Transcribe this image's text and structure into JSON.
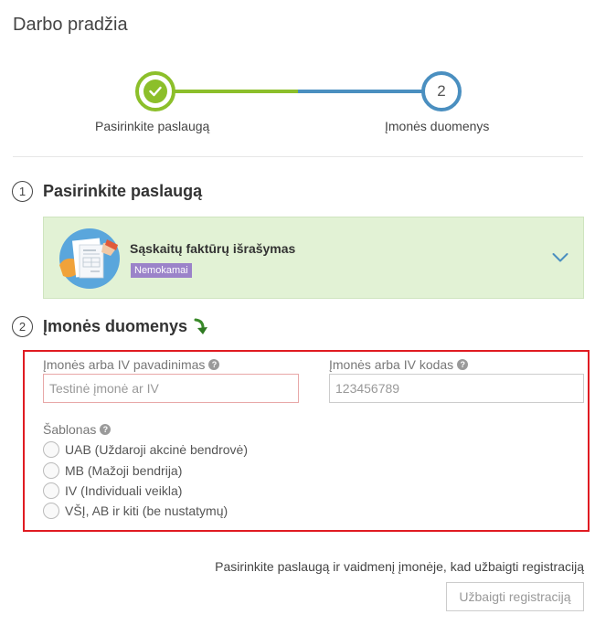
{
  "page": {
    "title": "Darbo pradžia"
  },
  "stepper": {
    "steps": [
      {
        "label": "Pasirinkite paslaugą",
        "state": "done"
      },
      {
        "label": "Įmonės duomenys",
        "number": "2",
        "state": "active"
      }
    ]
  },
  "sections": {
    "service": {
      "number": "1",
      "title": "Pasirinkite paslaugą"
    },
    "company": {
      "number": "2",
      "title": "Įmonės duomenys"
    }
  },
  "service_card": {
    "name": "Sąskaitų faktūrų išrašymas",
    "badge": "Nemokamai",
    "icon": "chevron-down-icon"
  },
  "form": {
    "name_label": "Įmonės arba IV pavadinimas",
    "name_placeholder": "Testinė įmonė ar IV",
    "code_label": "Įmonės arba IV kodas",
    "code_placeholder": "123456789",
    "template_label": "Šablonas",
    "template_options": [
      "UAB (Uždaroji akcinė bendrovė)",
      "MB (Mažoji bendrija)",
      "IV (Individuali veikla)",
      "VŠĮ, AB ir kiti (be nustatymų)"
    ]
  },
  "footer": {
    "note": "Pasirinkite paslaugą ir vaidmenį įmonėje, kad užbaigti registraciją",
    "submit_label": "Užbaigti registraciją"
  },
  "colors": {
    "step_done": "#8cbf2a",
    "step_active": "#4a8fc0",
    "card_bg": "#e2f2d5",
    "badge_bg": "#9b83c9",
    "error_border": "#e01b22"
  }
}
